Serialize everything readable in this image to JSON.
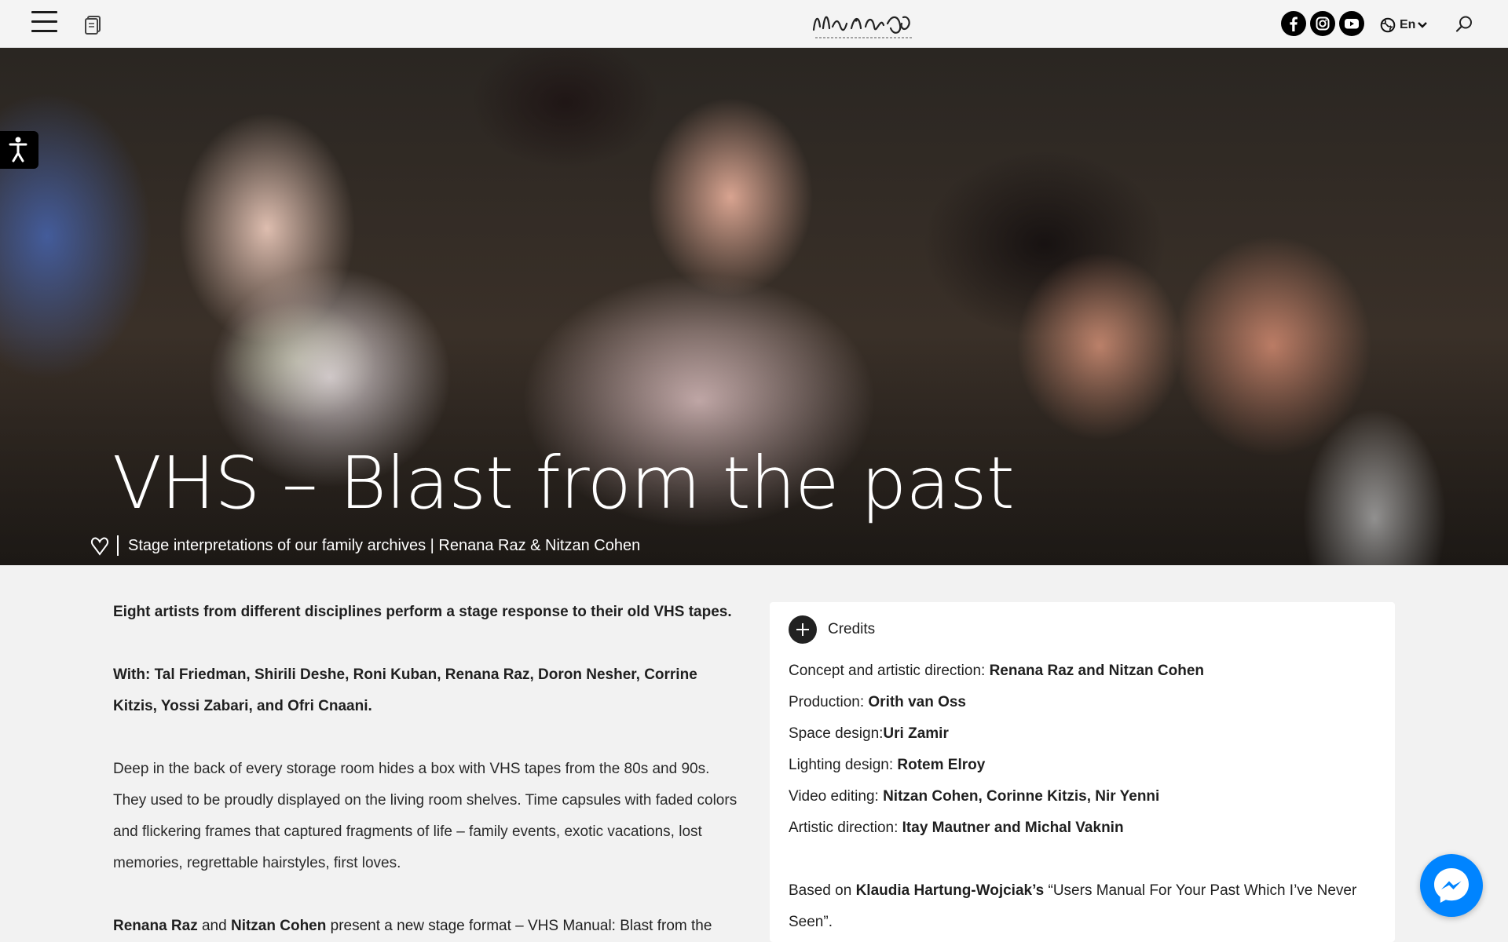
{
  "header": {
    "logo_icon": "organization-logo",
    "social": [
      {
        "name": "facebook-icon"
      },
      {
        "name": "instagram-icon"
      },
      {
        "name": "youtube-icon"
      }
    ],
    "language_label": "En",
    "colors": {
      "header_bg": "#f4f4f4",
      "icon": "#000000"
    }
  },
  "hero": {
    "title": "VHS – Blast from the past",
    "subtitle": "Stage interpretations of our family archives | Renana Raz & Nitzan Cohen"
  },
  "content": {
    "lead": "Eight artists from different disciplines perform a stage response to their old VHS tapes.",
    "with_line": "With: Tal Friedman, Shirili Deshe, Roni Kuban, Renana Raz, Doron Nesher, Corrine Kitzis, Yossi Zabari, and Ofri Cnaani.",
    "description": "Deep in the back of every storage room hides a box with VHS tapes from the 80s and 90s. They used to be proudly displayed on the living room shelves. Time capsules with faded colors and flickering frames that captured fragments of life – family events,  exotic vacations, lost memories, regrettable hairstyles, first loves.",
    "last": {
      "name1": "Renana Raz",
      "and": " and ",
      "name2": "Nitzan Cohen",
      "rest": " present a new stage format – VHS Manual: Blast from the"
    }
  },
  "credits": {
    "title": "Credits",
    "rows": [
      {
        "label": "Concept and artistic direction: ",
        "value": "Renana Raz and Nitzan Cohen"
      },
      {
        "label": "Production: ",
        "value": "Orith van Oss"
      },
      {
        "label": "Space design:",
        "value": "Uri Zamir"
      },
      {
        "label": "Lighting design: ",
        "value": "Rotem Elroy"
      },
      {
        "label": "Video editing: ",
        "value": "Nitzan Cohen, Corinne Kitzis, Nir Yenni"
      },
      {
        "label": "Artistic direction: ",
        "value": "Itay Mautner and Michal Vaknin"
      }
    ],
    "based": {
      "prefix": "Based on ",
      "author": "Klaudia Hartung-Wojciak’s",
      "work": " “Users Manual For Your Past Which I’ve Never Seen”."
    }
  },
  "widgets": {
    "messenger_color": "#0084ff"
  }
}
